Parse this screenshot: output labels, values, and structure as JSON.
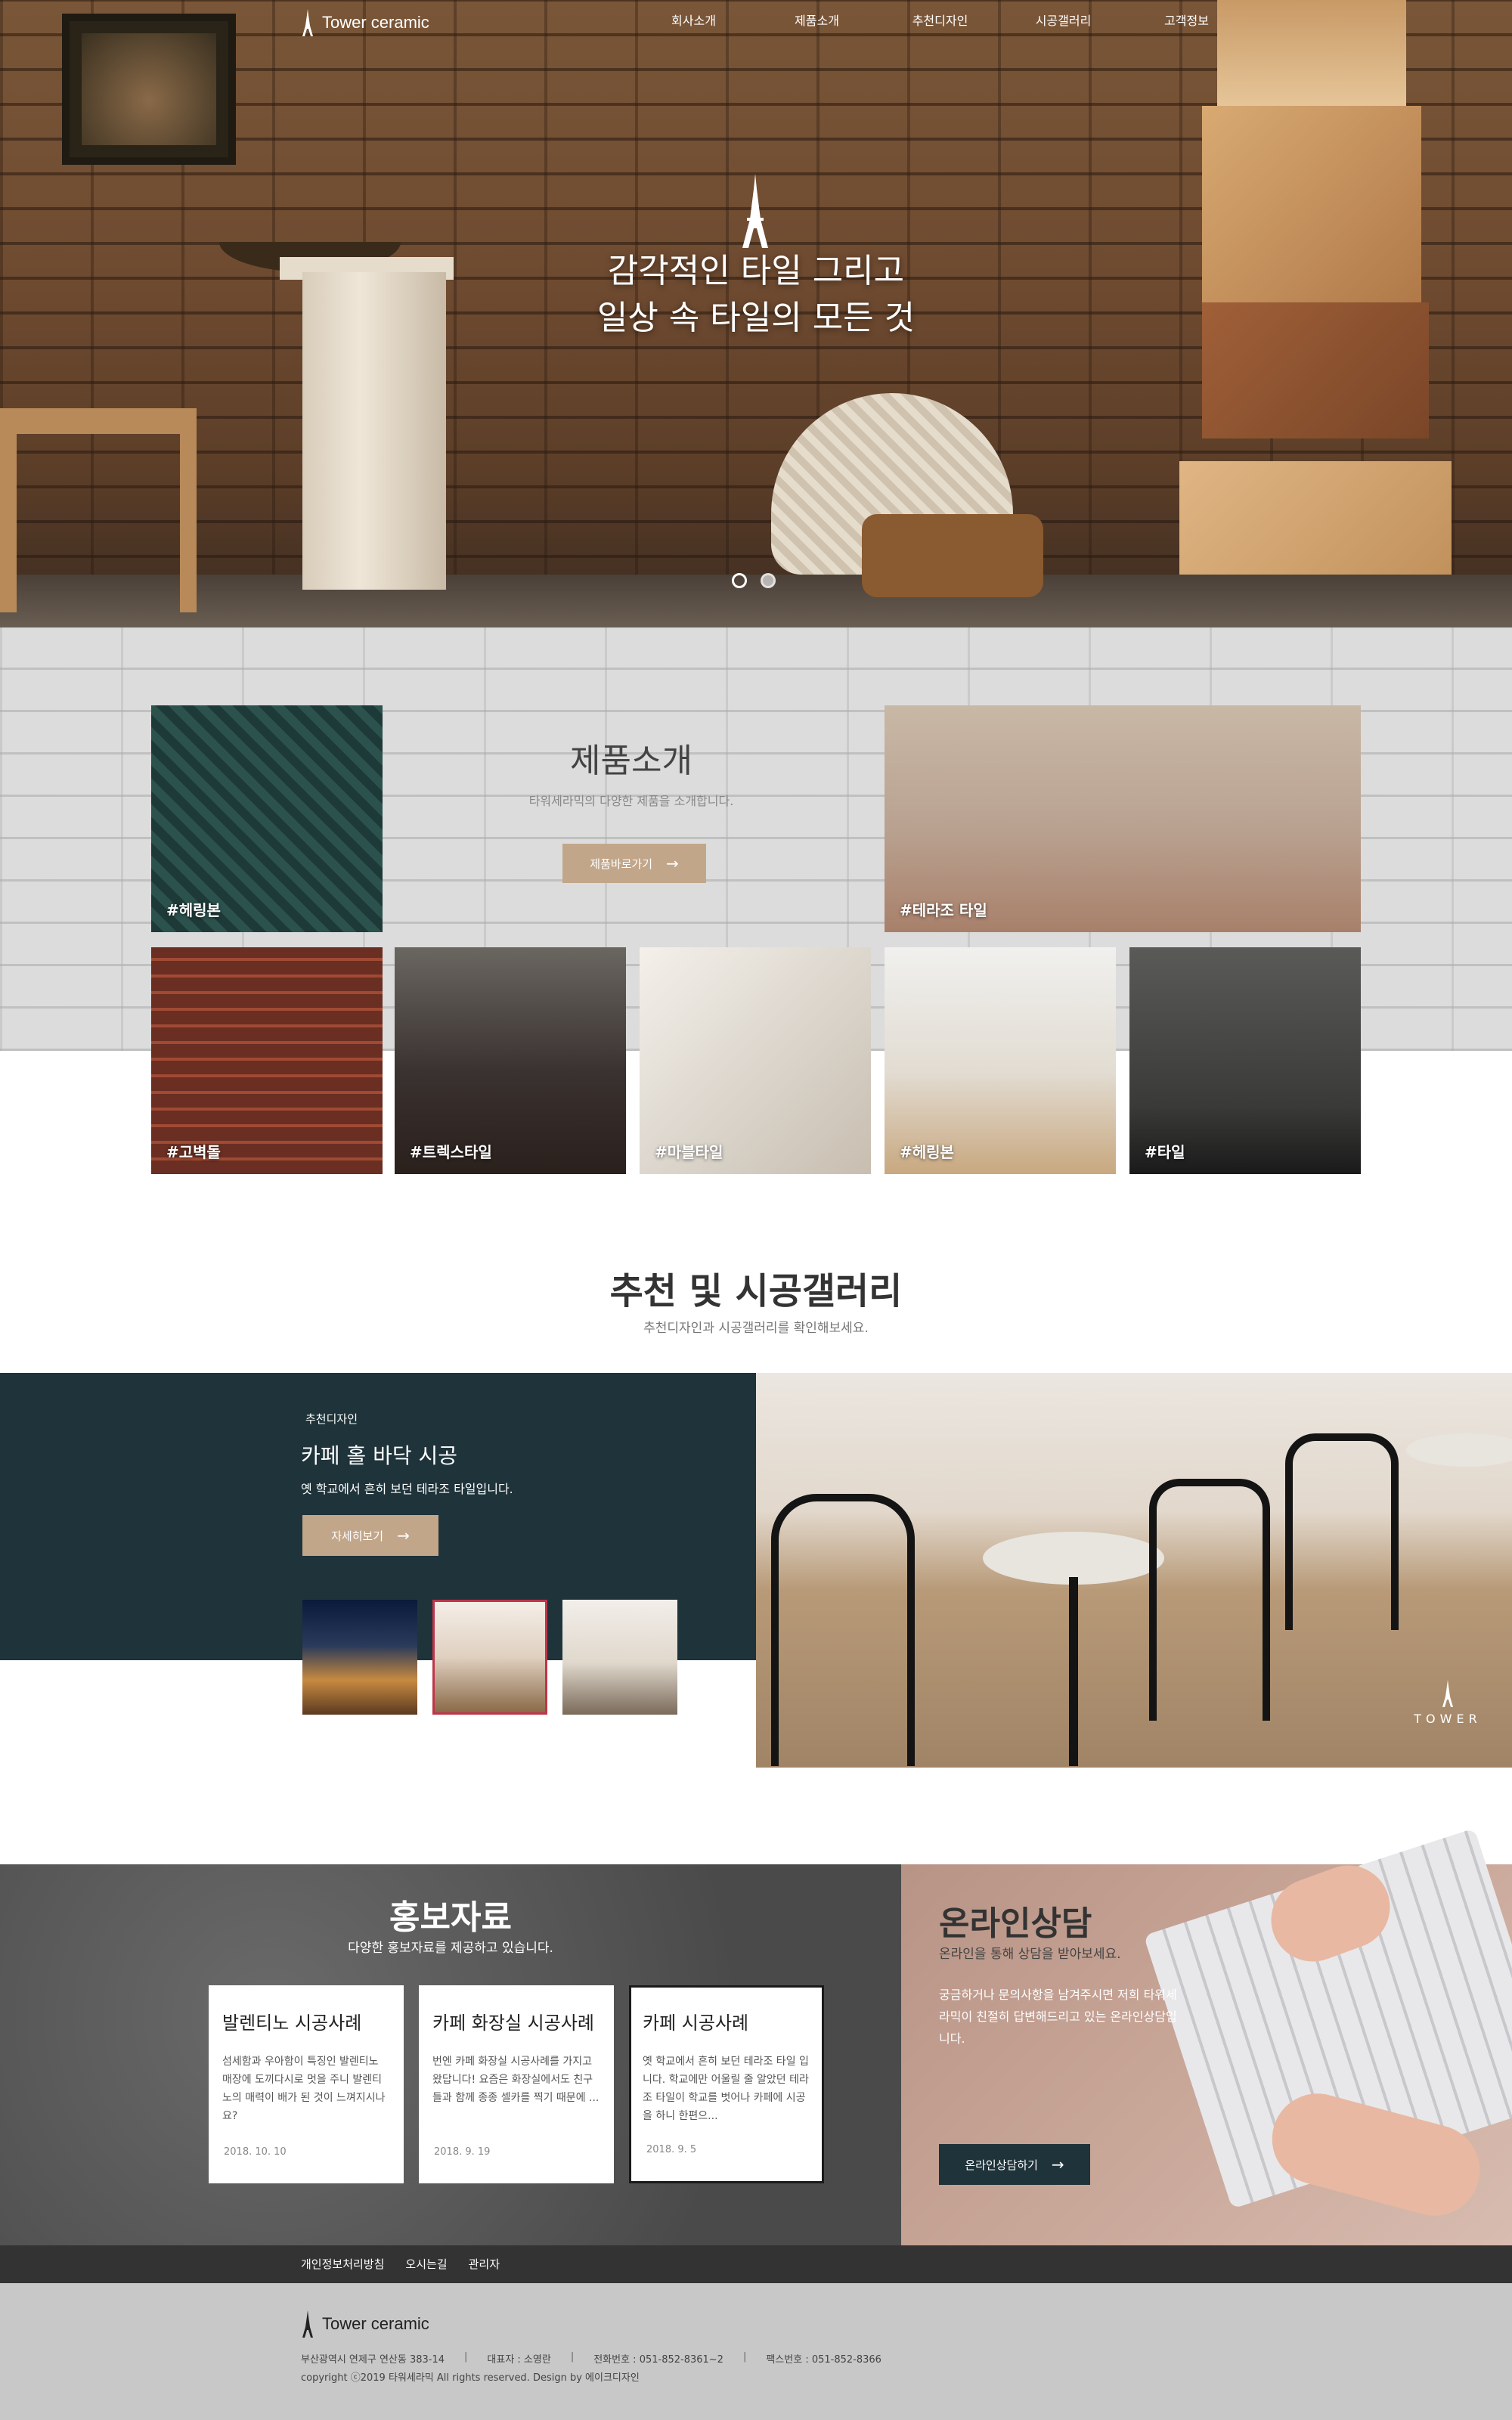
{
  "brand": {
    "name": "Tower ceramic"
  },
  "nav": {
    "items": [
      "회사소개",
      "제품소개",
      "추천디자인",
      "시공갤러리",
      "고객정보"
    ]
  },
  "hero": {
    "line1": "감각적인 타일 그리고",
    "line2": "일상 속 타일의 모든 것",
    "slide_count": 2,
    "active_slide": 1
  },
  "products": {
    "title": "제품소개",
    "subtitle": "타워세라믹의 다양한 제품을 소개합니다.",
    "button": "제품바로가기",
    "tiles": [
      "#헤링본",
      "#테라조 타일",
      "#고벽돌",
      "#트렉스타일",
      "#마블타일",
      "#헤링본",
      "#타일"
    ]
  },
  "gallery": {
    "title": "추천 및 시공갤러리",
    "subtitle": "추천디자인과 시공갤러리를 확인해보세요.",
    "category": "추천디자인",
    "heading": "카페 홀 바닥 시공",
    "description": "옛 학교에서 흔히 보던 테라조 타일입니다.",
    "button": "자세히보기",
    "watermark": "TOWER",
    "selected_thumb": 2
  },
  "pr": {
    "title": "홍보자료",
    "subtitle": "다양한 홍보자료를 제공하고 있습니다.",
    "cards": [
      {
        "title": "발렌티노 시공사례",
        "text": "섬세함과 우아함이 특징인 발렌티노 매장에 도끼다시로 멋을 주니 발렌티노의 매력이 배가 된 것이 느껴지시나요?",
        "date": "2018. 10. 10"
      },
      {
        "title": "카페 화장실 시공사례",
        "text": "번엔 카페 화장실 시공사례를 가지고 왔답니다! 요즘은 화장실에서도 친구들과 함께 종종 셀카를 찍기 때문에 ...",
        "date": "2018. 9. 19"
      },
      {
        "title": "카페 시공사례",
        "text": "옛 학교에서 흔히 보던 테라조 타일 입니다. 학교에만 어울릴 줄 알았던 테라조 타일이 학교를 벗어나 카페에 시공을 하니 한편으...",
        "date": "2018. 9. 5"
      }
    ]
  },
  "consult": {
    "title": "온라인상담",
    "subtitle": "온라인을 통해 상담을 받아보세요.",
    "text": "궁금하거나 문의사항을 남겨주시면 저희 타워세라믹이 친절히 답변해드리고 있는 온라인상담입니다.",
    "button": "온라인상담하기"
  },
  "footer": {
    "links": [
      "개인정보처리방침",
      "오시는길",
      "관리자"
    ],
    "address": "부산광역시 연제구 연산동 383-14",
    "ceo": "대표자 : 소영란",
    "phone": "전화번호 : 051-852-8361~2",
    "fax": "팩스번호 : 051-852-8366",
    "copyright": "copyright ⓒ2019 타워세라믹 All rights reserved. Design by 에이크디자인"
  },
  "colors": {
    "tan": "#c2a68a",
    "navy": "#1f333a",
    "footer": "#c8c8c8"
  }
}
